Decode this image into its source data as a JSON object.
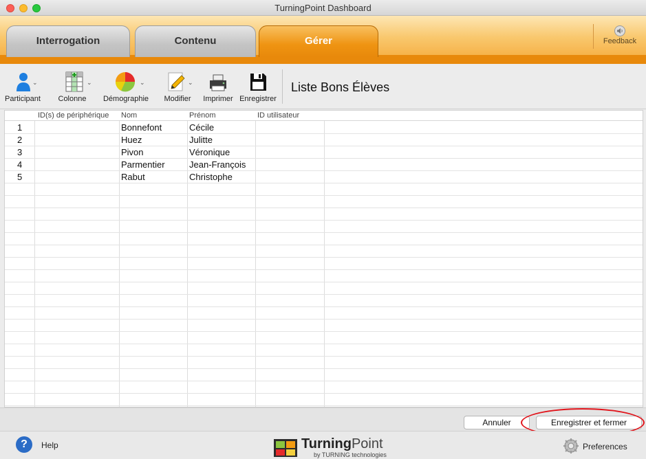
{
  "window": {
    "title": "TurningPoint Dashboard"
  },
  "tabs": [
    {
      "label": "Interrogation",
      "active": false
    },
    {
      "label": "Contenu",
      "active": false
    },
    {
      "label": "Gérer",
      "active": true
    }
  ],
  "feedback": {
    "label": "Feedback",
    "icon": "speaker-icon"
  },
  "toolbar": {
    "items": [
      {
        "label": "Participant",
        "icon": "participant-icon",
        "has_menu": true
      },
      {
        "label": "Colonne",
        "icon": "column-icon",
        "has_menu": true
      },
      {
        "label": "Démographie",
        "icon": "pie-chart-icon",
        "has_menu": true
      },
      {
        "label": "Modifier",
        "icon": "pencil-icon",
        "has_menu": true
      },
      {
        "label": "Imprimer",
        "icon": "printer-icon",
        "has_menu": false
      },
      {
        "label": "Enregistrer",
        "icon": "save-icon",
        "has_menu": false
      }
    ],
    "list_title": "Liste Bons Élèves"
  },
  "table": {
    "columns": [
      "",
      "ID(s) de périphérique",
      "Nom",
      "Prénom",
      "ID utilisateur"
    ],
    "rows": [
      [
        "1",
        "",
        "Bonnefont",
        "Cécile",
        ""
      ],
      [
        "2",
        "",
        "Huez",
        "Julitte",
        ""
      ],
      [
        "3",
        "",
        "Pivon",
        "Véronique",
        ""
      ],
      [
        "4",
        "",
        "Parmentier",
        "Jean-François",
        ""
      ],
      [
        "5",
        "",
        "Rabut",
        "Christophe",
        ""
      ]
    ]
  },
  "footer": {
    "cancel_label": "Annuler",
    "save_close_label": "Enregistrer et fermer",
    "highlight_color": "#e1141b"
  },
  "statusbar": {
    "help_label": "Help",
    "brand_bold": "Turning",
    "brand_light": "Point",
    "brand_sub": "by TURNING technologies",
    "preferences_label": "Preferences"
  },
  "colors": {
    "accent": "#e8890b",
    "active_tab": "#ef9412"
  }
}
